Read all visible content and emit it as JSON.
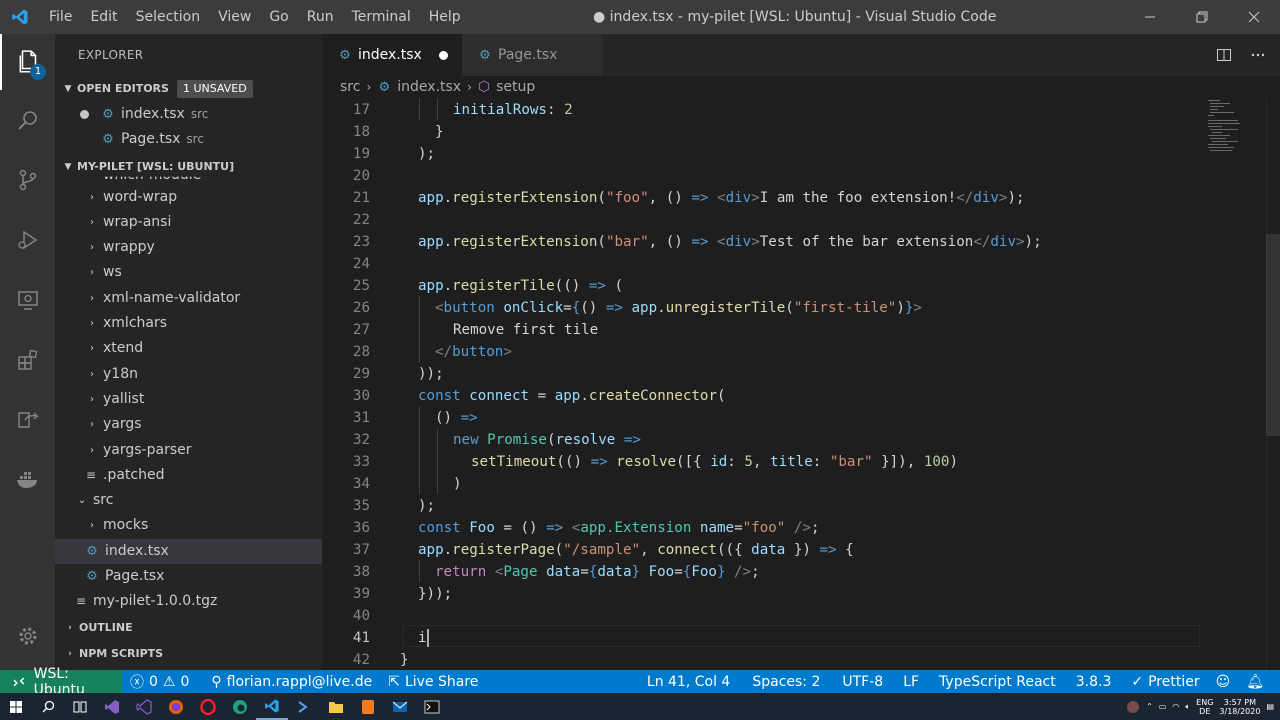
{
  "app": {
    "window_title": "● index.tsx - my-pilet [WSL: Ubuntu] - Visual Studio Code",
    "menu": [
      "File",
      "Edit",
      "Selection",
      "View",
      "Go",
      "Run",
      "Terminal",
      "Help"
    ]
  },
  "activity": {
    "explorer_badge": "1"
  },
  "sidebar": {
    "title": "EXPLORER",
    "open_editors": {
      "label": "OPEN EDITORS",
      "badge": "1 UNSAVED",
      "items": [
        {
          "name": "index.tsx",
          "desc": "src"
        },
        {
          "name": "Page.tsx",
          "desc": "src"
        }
      ]
    },
    "workspace": {
      "label": "MY-PILET [WSL: UBUNTU]",
      "partial_item": "which-module",
      "folders": [
        "word-wrap",
        "wrap-ansi",
        "wrappy",
        "ws",
        "xml-name-validator",
        "xmlchars",
        "xtend",
        "y18n",
        "yallist",
        "yargs",
        "yargs-parser"
      ],
      "patched": ".patched",
      "src": "src",
      "mocks": "mocks",
      "src_files": [
        "index.tsx",
        "Page.tsx"
      ],
      "tgz": "my-pilet-1.0.0.tgz"
    },
    "outline": "OUTLINE",
    "npm_scripts": "NPM SCRIPTS"
  },
  "tabs": [
    {
      "name": "index.tsx",
      "active": true,
      "dirty": true
    },
    {
      "name": "Page.tsx",
      "active": false,
      "dirty": false
    }
  ],
  "breadcrumb": [
    "src",
    "index.tsx",
    "setup"
  ],
  "editor": {
    "line_numbers": [
      "17",
      "18",
      "19",
      "20",
      "21",
      "22",
      "23",
      "24",
      "25",
      "26",
      "27",
      "28",
      "29",
      "30",
      "31",
      "32",
      "33",
      "34",
      "35",
      "36",
      "37",
      "38",
      "39",
      "40",
      "41",
      "42"
    ],
    "line17": [
      "initialRows",
      ": ",
      "2"
    ],
    "line18": "}",
    "line19": ");",
    "line21": [
      "app",
      ".",
      "registerExtension",
      "(",
      "\"foo\"",
      ", () ",
      "=>",
      " ",
      "<",
      "div",
      ">",
      "I am the foo extension!",
      "</",
      "div",
      ">",
      ");"
    ],
    "line23": [
      "app",
      ".",
      "registerExtension",
      "(",
      "\"bar\"",
      ", () ",
      "=>",
      " ",
      "<",
      "div",
      ">",
      "Test of the bar extension",
      "</",
      "div",
      ">",
      ");"
    ],
    "line25": [
      "app",
      ".",
      "registerTile",
      "(() ",
      "=>",
      " ("
    ],
    "line26": [
      "<",
      "button",
      " ",
      "onClick",
      "=",
      "{",
      "() ",
      "=>",
      " ",
      "app",
      ".",
      "unregisterTile",
      "(",
      "\"first-tile\"",
      ")",
      "}",
      ">"
    ],
    "line27": "Remove first tile",
    "line28": [
      "</",
      "button",
      ">"
    ],
    "line29": "));",
    "line30": [
      "const",
      " ",
      "connect",
      " = ",
      "app",
      ".",
      "createConnector",
      "("
    ],
    "line31": [
      "() ",
      "=>"
    ],
    "line32": [
      "new",
      " ",
      "Promise",
      "(",
      "resolve",
      " ",
      "=>"
    ],
    "line33": [
      "setTimeout",
      "(() ",
      "=>",
      " ",
      "resolve",
      "([{ ",
      "id",
      ": ",
      "5",
      ", ",
      "title",
      ": ",
      "\"bar\"",
      " }]), ",
      "100",
      ")"
    ],
    "line34": ")",
    "line35": ");",
    "line36": [
      "const",
      " ",
      "Foo",
      " = () ",
      "=>",
      " ",
      "<",
      "app.Extension",
      " ",
      "name",
      "=",
      "\"foo\"",
      " ",
      "/>",
      ";"
    ],
    "line37": [
      "app",
      ".",
      "registerPage",
      "(",
      "\"/sample\"",
      ", ",
      "connect",
      "(({ ",
      "data",
      " }) ",
      "=>",
      " {"
    ],
    "line38": [
      "return",
      " ",
      "<",
      "Page",
      " ",
      "data",
      "=",
      "{",
      "data",
      "}",
      " ",
      "Foo",
      "=",
      "{",
      "Foo",
      "}",
      " ",
      "/>",
      ";"
    ],
    "line39": "}));",
    "line41": "i",
    "line42": "}"
  },
  "status": {
    "remote": "WSL: Ubuntu",
    "errors": "0",
    "warnings": "0",
    "account": "florian.rappl@live.de",
    "liveshare": "Live Share",
    "position": "Ln 41, Col 4",
    "spaces": "Spaces: 2",
    "encoding": "UTF-8",
    "eol": "LF",
    "language": "TypeScript React",
    "version": "3.8.3",
    "formatter": "Prettier"
  },
  "taskbar": {
    "lang": "ENG",
    "region": "DE",
    "time": "3:57 PM",
    "date": "3/18/2020"
  },
  "colors": {
    "statusbar": "#007acc",
    "remote": "#16825d",
    "activitybar": "#333333",
    "sidebar": "#252526",
    "editor": "#1e1e1e"
  }
}
